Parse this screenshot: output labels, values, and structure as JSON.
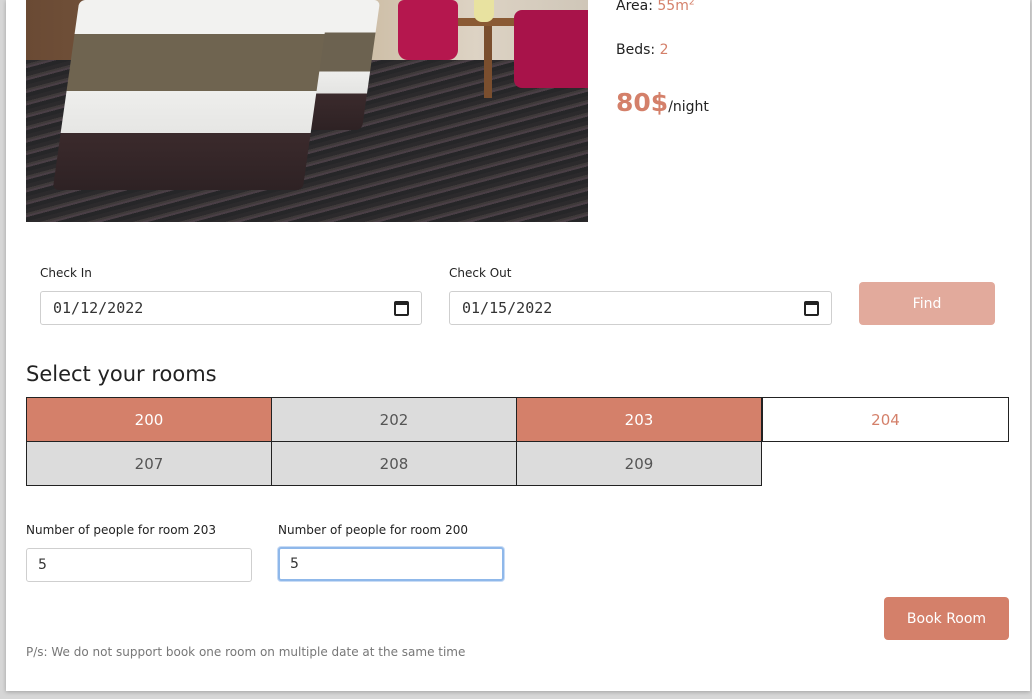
{
  "room_info": {
    "area_label": "Area:",
    "area_value": "55m",
    "area_unit_sup": "2",
    "beds_label": "Beds:",
    "beds_value": "2",
    "price_amount": "80$",
    "price_unit": "/night"
  },
  "booking_form": {
    "check_in_label": "Check In",
    "check_in_value": "01/12/2022",
    "check_out_label": "Check Out",
    "check_out_value": "01/15/2022",
    "find_label": "Find"
  },
  "rooms": {
    "title": "Select your rooms",
    "items": [
      {
        "number": "200",
        "state": "selected"
      },
      {
        "number": "202",
        "state": "unavailable"
      },
      {
        "number": "203",
        "state": "selected"
      },
      {
        "number": "204",
        "state": "available"
      },
      {
        "number": "207",
        "state": "unavailable"
      },
      {
        "number": "208",
        "state": "unavailable"
      },
      {
        "number": "209",
        "state": "unavailable"
      }
    ]
  },
  "people": {
    "room_203_label": "Number of people for room 203",
    "room_203_value": "5",
    "room_200_label": "Number of people for room 200",
    "room_200_value": "5"
  },
  "actions": {
    "book_label": "Book Room"
  },
  "note": "P/s: We do not support book one room on multiple date at the same time",
  "colors": {
    "accent": "#d4806a",
    "accent_disabled": "#e2aa9c",
    "unavailable": "#dcdcdc",
    "focus": "#8fb8ea"
  }
}
